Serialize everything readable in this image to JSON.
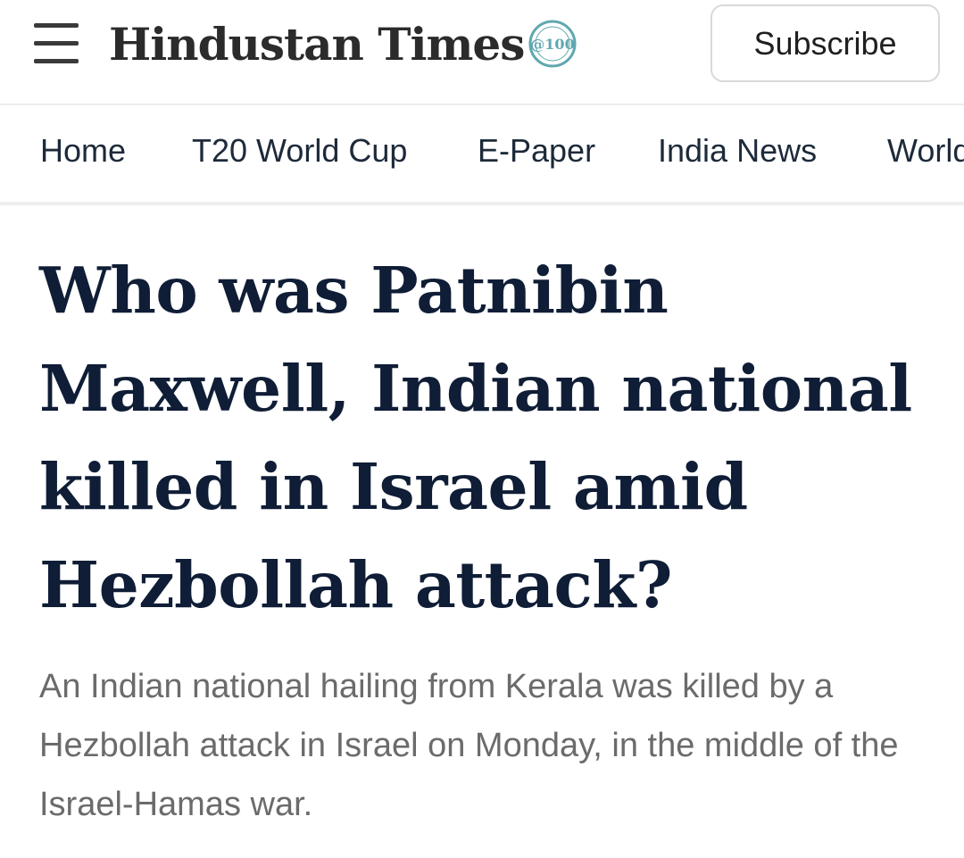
{
  "header": {
    "menu_icon": "hamburger-menu-icon",
    "logo_text": "Hindustan Times",
    "logo_badge_text": "@100",
    "subscribe_label": "Subscribe"
  },
  "nav": {
    "items": [
      {
        "label": "Home"
      },
      {
        "label": "T20 World Cup"
      },
      {
        "label": "E-Paper"
      },
      {
        "label": "India News"
      },
      {
        "label": "World"
      }
    ]
  },
  "article": {
    "headline": "Who was Patnibin Maxwell, Indian national killed in Israel amid Hezbollah attack?",
    "summary": "An Indian national hailing from Kerala was killed by a Hezbollah attack in Israel on Monday, in the middle of the Israel-Hamas war."
  },
  "colors": {
    "headline": "#0f1d36",
    "summary": "#6b6b6b",
    "nav_text": "#1d2a3a",
    "badge_teal": "#5fa7b0"
  }
}
